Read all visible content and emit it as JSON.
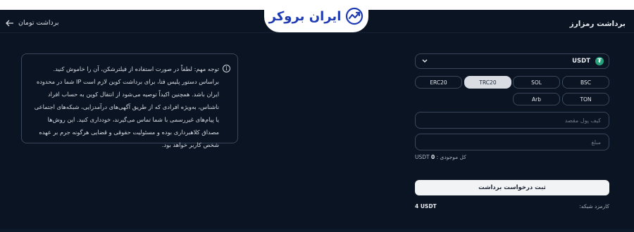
{
  "logo": {
    "text": "ایران بروکر",
    "brand_color": "#1f3bb3"
  },
  "header": {
    "title": "برداشت رمزارز",
    "back_link": "برداشت تومان"
  },
  "notice": {
    "icon": "info-icon",
    "text": "توجه مهم: لطفاً در صورت استفاده از فیلترشکن، آن را خاموش کنید. براساس دستور پلیس فتا، برای برداشت کوین لازم است IP شما در محدوده ایران باشد. همچنین اکیداً توصیه می‌شود از انتقال کوین به حساب افراد ناشناس، به‌ویژه افرادی که از طریق آگهی‌های درآمدزایی، شبکه‌های اجتماعی یا پیام‌های غیررسمی با شما تماس می‌گیرند، خودداری کنید. این روش‌ها مصداق کلاهبرداری بوده و مسئولیت حقوقی و قضایی هرگونه جرم بر عهده شخص کاربر خواهد بود."
  },
  "currency": {
    "selected": "USDT",
    "icon": "tether-icon",
    "icon_color": "#26a17b"
  },
  "networks": {
    "row1": [
      "BSC",
      "SOL",
      "TRC20",
      "ERC20"
    ],
    "row2": [
      "TON",
      "Arb"
    ],
    "active": "TRC20"
  },
  "form": {
    "wallet_placeholder": "کیف پول مقصد",
    "amount_placeholder": "مبلغ",
    "balance_label": "کل موجودی :",
    "balance_unit": "USDT",
    "balance_value": "0",
    "submit_label": "ثبت درخواست برداشت",
    "fee_label": "کارمزد شبکه:",
    "fee_value": "4 USDT"
  },
  "colors": {
    "background": "#0b1423",
    "border": "#3a475a",
    "active_chip": "#d9dde3"
  }
}
